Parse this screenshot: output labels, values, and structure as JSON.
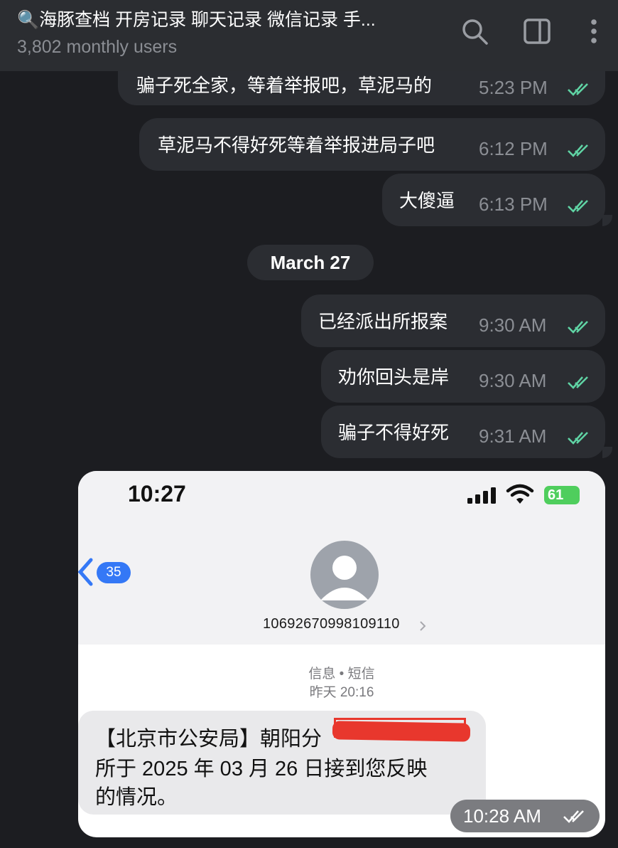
{
  "header": {
    "title": "🔍海豚查档 开房记录 聊天记录 微信记录 手...",
    "subtitle": "3,802 monthly users"
  },
  "messages": [
    {
      "text": "骗子死全家，等着举报吧，草泥马的",
      "time": "5:23 PM"
    },
    {
      "text": "草泥马不得好死等着举报进局子吧",
      "time": "6:12 PM"
    },
    {
      "text": "大傻逼",
      "time": "6:13 PM"
    },
    {
      "text": "已经派出所报案",
      "time": "9:30 AM"
    },
    {
      "text": "劝你回头是岸",
      "time": "9:30 AM"
    },
    {
      "text": "骗子不得好死",
      "time": "9:31 AM"
    }
  ],
  "date_separator": "March 27",
  "photo": {
    "clock": "10:27",
    "battery": "61",
    "back_count": "35",
    "sender_number": "10692670998109110",
    "meta_type": "信息 • 短信",
    "meta_time": "昨天 20:16",
    "sms_lines": [
      "【北京市公安局】朝阳分",
      "所于 2025 年 03 月 26 日接到您反映",
      "的情况。"
    ],
    "timestamp": "10:28 AM"
  },
  "colors": {
    "background": "#1c1d21",
    "bubble": "#2b2d32",
    "check": "#5fd3a4",
    "ios_blue": "#3478f6",
    "redaction": "#e8372d"
  }
}
